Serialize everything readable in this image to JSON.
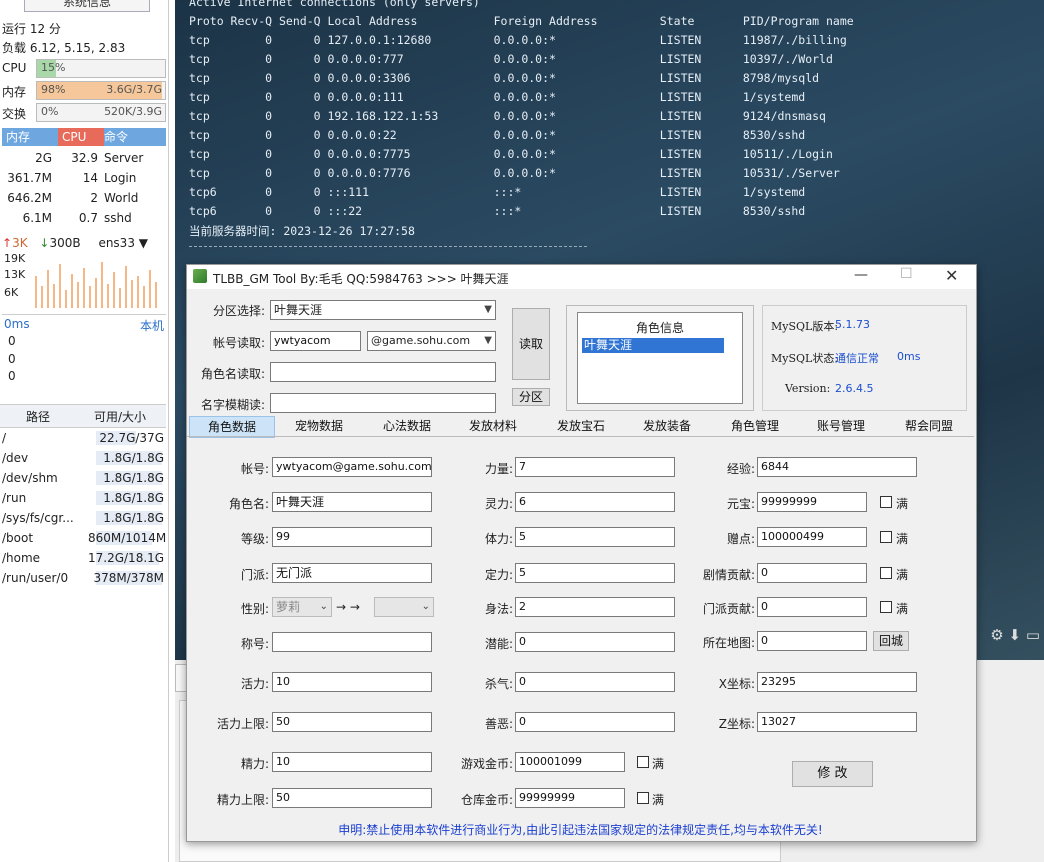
{
  "left": {
    "sysinfo_btn": "系统信息",
    "uptime": "运行 12 分",
    "load": "负载 6.12, 5.15, 2.83",
    "cpu": {
      "label": "CPU",
      "value": "15%",
      "fill": 0.15
    },
    "mem": {
      "label": "内存",
      "value": "98%",
      "right": "3.6G/3.7G",
      "fill": 0.98
    },
    "swap": {
      "label": "交换",
      "value": "0%",
      "right": "520K/3.9G",
      "fill": 0.0
    },
    "proc_headers": [
      "内存",
      "CPU",
      "命令"
    ],
    "procs": [
      {
        "mem": "2G",
        "cpu": "32.9",
        "cmd": "Server"
      },
      {
        "mem": "361.7M",
        "cpu": "14",
        "cmd": "Login"
      },
      {
        "mem": "646.2M",
        "cpu": "2",
        "cmd": "World"
      },
      {
        "mem": "6.1M",
        "cpu": "0.7",
        "cmd": "sshd"
      }
    ],
    "net_up": "3K",
    "net_down": "300B",
    "iface": "ens33",
    "net_scale": [
      "19K",
      "13K",
      "6K"
    ],
    "ping_label": "0ms",
    "ping_host": "本机",
    "ping_scale": [
      "0",
      "0",
      "0"
    ],
    "disk_headers": [
      "路径",
      "可用/大小"
    ],
    "disks": [
      {
        "path": "/",
        "size": "22.7G/37G",
        "fill": 0.61
      },
      {
        "path": "/dev",
        "size": "1.8G/1.8G",
        "fill": 1.0
      },
      {
        "path": "/dev/shm",
        "size": "1.8G/1.8G",
        "fill": 1.0
      },
      {
        "path": "/run",
        "size": "1.8G/1.8G",
        "fill": 1.0
      },
      {
        "path": "/sys/fs/cgr...",
        "size": "1.8G/1.8G",
        "fill": 1.0
      },
      {
        "path": "/boot",
        "size": "860M/1014M",
        "fill": 0.85
      },
      {
        "path": "/home",
        "size": "17.2G/18.1G",
        "fill": 0.95
      },
      {
        "path": "/run/user/0",
        "size": "378M/378M",
        "fill": 1.0
      }
    ]
  },
  "terminal": {
    "lines": [
      "Active Internet connections (only servers)",
      "Proto Recv-Q Send-Q Local Address           Foreign Address         State       PID/Program name",
      "tcp        0      0 127.0.0.1:12680         0.0.0.0:*               LISTEN      11987/./billing",
      "tcp        0      0 0.0.0.0:777             0.0.0.0:*               LISTEN      10397/./World",
      "tcp        0      0 0.0.0.0:3306            0.0.0.0:*               LISTEN      8798/mysqld",
      "tcp        0      0 0.0.0.0:111             0.0.0.0:*               LISTEN      1/systemd",
      "tcp        0      0 192.168.122.1:53        0.0.0.0:*               LISTEN      9124/dnsmasq",
      "tcp        0      0 0.0.0.0:22              0.0.0.0:*               LISTEN      8530/sshd",
      "tcp        0      0 0.0.0.0:7775            0.0.0.0:*               LISTEN      10511/./Login",
      "tcp        0      0 0.0.0.0:7776            0.0.0.0:*               LISTEN      10531/./Server",
      "tcp6       0      0 :::111                  :::*                    LISTEN      1/systemd",
      "tcp6       0      0 :::22                   :::*                    LISTEN      8530/sshd",
      "当前服务器时间: 2023-12-26 17:27:58"
    ]
  },
  "window": {
    "title": "TLBB_GM Tool By:毛毛 QQ:5984763 >>> 叶舞天涯",
    "zone_label": "分区选择:",
    "zone_value": "叶舞天涯",
    "account_label": "帐号读取:",
    "account_value": "ywtyacom",
    "domain_value": "@game.sohu.com",
    "rolename_label": "角色名读取:",
    "fuzzy_label": "名字模糊读:",
    "read_btn": "读取",
    "zone_btn": "分区",
    "role_info_title": "角色信息",
    "role_list": [
      "叶舞天涯"
    ],
    "mysql_version_label": "MySQL版本:",
    "mysql_version": "5.1.73",
    "mysql_status_label": "MySQL状态:",
    "mysql_status": "通信正常",
    "mysql_ping": "0ms",
    "version_label": "Version:",
    "version": "2.6.4.5",
    "tabs": [
      "角色数据",
      "宠物数据",
      "心法数据",
      "发放材料",
      "发放宝石",
      "发放装备",
      "角色管理",
      "账号管理",
      "帮会同盟"
    ],
    "fields": {
      "account": {
        "label": "帐号:",
        "value": "ywtyacom@game.sohu.com"
      },
      "rolename": {
        "label": "角色名:",
        "value": "叶舞天涯"
      },
      "level": {
        "label": "等级:",
        "value": "99"
      },
      "sect": {
        "label": "门派:",
        "value": "无门派"
      },
      "gender": {
        "label": "性别:",
        "value": "萝莉"
      },
      "arrow": "→ →",
      "title_f": {
        "label": "称号:",
        "value": ""
      },
      "vitality": {
        "label": "活力:",
        "value": "10"
      },
      "vitality_max": {
        "label": "活力上限:",
        "value": "50"
      },
      "energy": {
        "label": "精力:",
        "value": "10"
      },
      "energy_max": {
        "label": "精力上限:",
        "value": "50"
      },
      "strength": {
        "label": "力量:",
        "value": "7"
      },
      "spirit": {
        "label": "灵力:",
        "value": "6"
      },
      "stamina": {
        "label": "体力:",
        "value": "5"
      },
      "focus": {
        "label": "定力:",
        "value": "5"
      },
      "agility": {
        "label": "身法:",
        "value": "2"
      },
      "potential": {
        "label": "潜能:",
        "value": "0"
      },
      "killing": {
        "label": "杀气:",
        "value": "0"
      },
      "goodevil": {
        "label": "善恶:",
        "value": "0"
      },
      "gold": {
        "label": "游戏金币:",
        "value": "100001099"
      },
      "bank_gold": {
        "label": "仓库金币:",
        "value": "99999999"
      },
      "exp": {
        "label": "经验:",
        "value": "6844"
      },
      "yuanbao": {
        "label": "元宝:",
        "value": "99999999"
      },
      "bonus": {
        "label": "赠点:",
        "value": "100000499"
      },
      "story": {
        "label": "剧情贡献:",
        "value": "0"
      },
      "sect_contrib": {
        "label": "门派贡献:",
        "value": "0"
      },
      "map": {
        "label": "所在地图:",
        "value": "0"
      },
      "x": {
        "label": "X坐标:",
        "value": "23295"
      },
      "z": {
        "label": "Z坐标:",
        "value": "13027"
      }
    },
    "full_label": "满",
    "return_btn": "回城",
    "modify_btn": "修 改",
    "disclaimer": "申明:禁止使用本软件进行商业行为,由此引起违法国家规定的法律规定责任,均与本软件无关!"
  }
}
